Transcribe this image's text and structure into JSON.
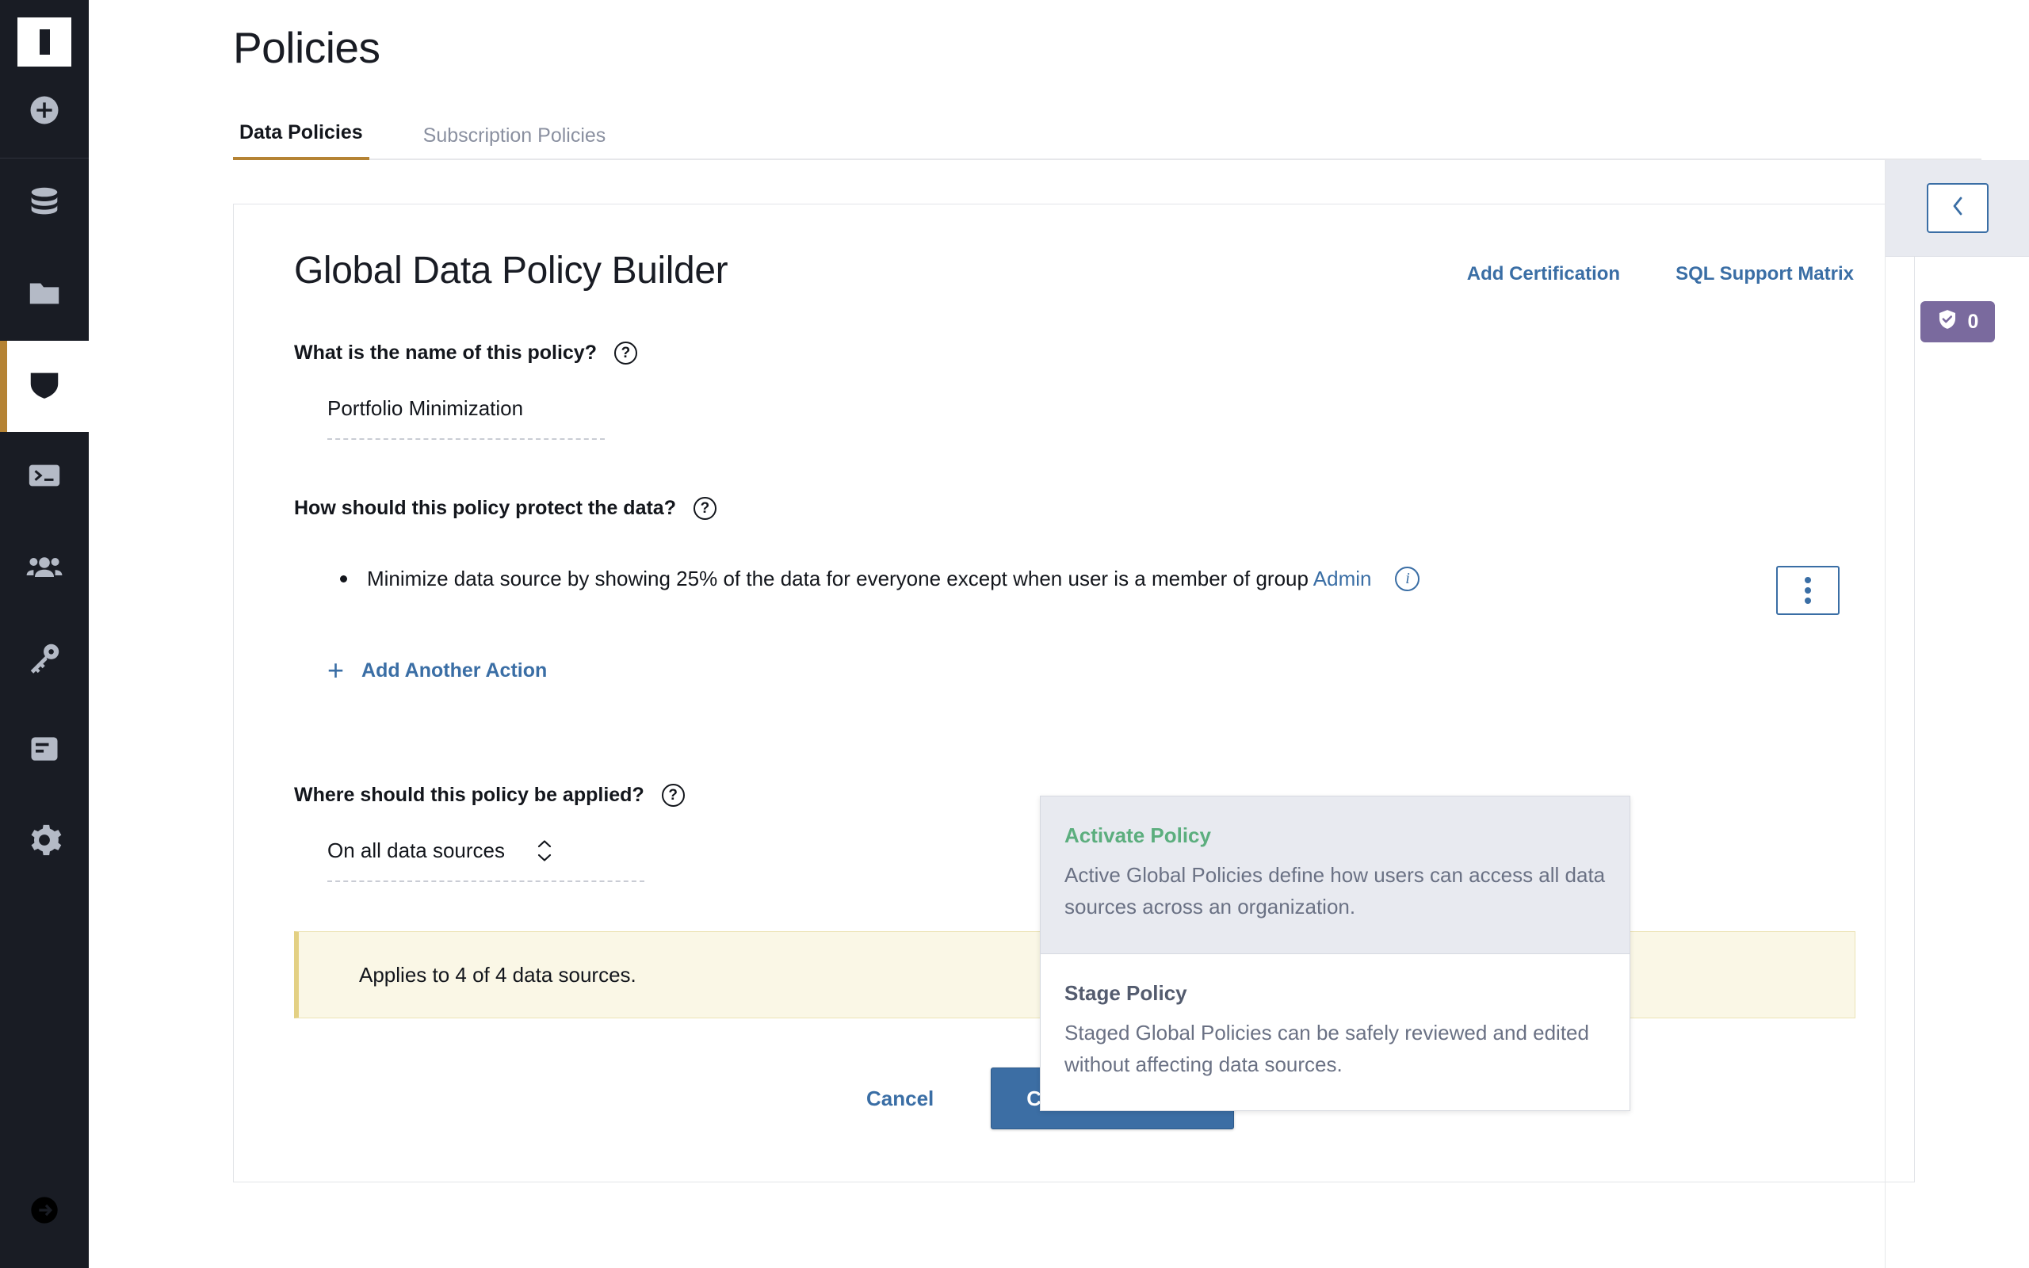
{
  "sidebar": {
    "logo_name": "app-logo",
    "items": [
      {
        "icon": "plus-circle-icon",
        "name": "add"
      },
      {
        "icon": "database-icon",
        "name": "data-sources"
      },
      {
        "icon": "folder-icon",
        "name": "projects"
      },
      {
        "icon": "shield-icon",
        "name": "policies",
        "active": true
      },
      {
        "icon": "terminal-icon",
        "name": "console"
      },
      {
        "icon": "users-icon",
        "name": "users"
      },
      {
        "icon": "key-icon",
        "name": "keys"
      },
      {
        "icon": "report-icon",
        "name": "reports"
      },
      {
        "icon": "gear-icon",
        "name": "settings"
      }
    ],
    "bottom": {
      "icon": "logout-icon",
      "name": "logout"
    }
  },
  "header": {
    "title": "Policies"
  },
  "tabs": [
    {
      "label": "Data Policies",
      "active": true
    },
    {
      "label": "Subscription Policies",
      "active": false
    }
  ],
  "card": {
    "title": "Global Data Policy Builder",
    "links": [
      {
        "label": "Add Certification"
      },
      {
        "label": "SQL Support Matrix"
      }
    ],
    "name_question": "What is the name of this policy?",
    "name_value": "Portfolio Minimization",
    "protect_question": "How should this policy protect the data?",
    "action": {
      "text_before_link": "Minimize data source by showing 25% of the data for everyone except when user is a member of group",
      "link_label": "Admin",
      "info_icon": "info-icon",
      "kebab_icon": "kebab-menu-icon"
    },
    "add_action_label": "Add Another Action",
    "apply_question": "Where should this policy be applied?",
    "apply_value": "On all data sources",
    "alert_text": "Applies to 4 of 4 data sources."
  },
  "footer": {
    "cancel_label": "Cancel",
    "create_label": "Create Policy"
  },
  "dropdown": {
    "items": [
      {
        "title": "Activate Policy",
        "desc": "Active Global Policies define how users can access all data sources across an organization.",
        "selected": true
      },
      {
        "title": "Stage Policy",
        "desc": "Staged Global Policies can be safely reviewed and edited without affecting data sources.",
        "selected": false
      }
    ]
  },
  "right_rail": {
    "collapse_icon": "chevron-left-icon",
    "badge_icon": "shield-check-icon",
    "badge_count": "0"
  },
  "colors": {
    "accent_gold": "#b58334",
    "link_blue": "#3a6ea5",
    "button_blue": "#3c6ea4",
    "sidebar_dark": "#191c24",
    "alert_yellow": "#faf7e6",
    "badge_purple": "#7a6a9e",
    "green": "#5cae7e"
  }
}
